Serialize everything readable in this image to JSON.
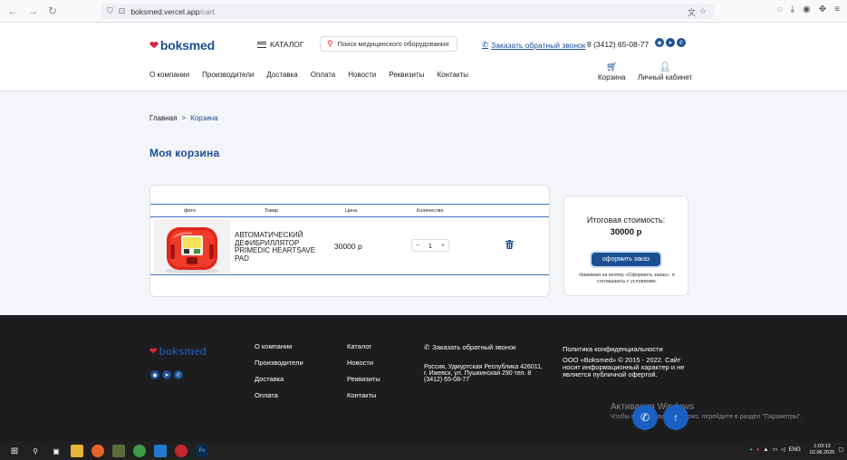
{
  "browser": {
    "url_host": "boksmed.vercel.app",
    "url_path": "/cart"
  },
  "header": {
    "logo": "boksmed",
    "catalog_label": "КАТАЛОГ",
    "search_placeholder": "Поиск медицинского оборудования",
    "callback_label": "Заказать обратный звонок",
    "phone": "8 (3412) 65-08-77",
    "nav": [
      "О компании",
      "Производители",
      "Доставка",
      "Оплата",
      "Новости",
      "Реквизиты",
      "Контакты"
    ],
    "cart_label": "Корзина",
    "account_label": "Личный кабинет"
  },
  "breadcrumb": {
    "home": "Главная",
    "separator": ">",
    "current": "Корзина"
  },
  "page_title": "Моя корзина",
  "cart": {
    "columns": [
      "фото",
      "Товар",
      "Цена",
      "Количество"
    ],
    "items": [
      {
        "name": "АВТОМАТИЧЕСКИЙ ДЕФИБРИЛЛЯТОР PRIMEDIC HEARTSAVE PAD",
        "price": "30000 р",
        "quantity": "1"
      }
    ]
  },
  "summary": {
    "label": "Итоговая стоимость:",
    "total": "30000 р",
    "order_button": "оформить заказ",
    "note": "Нажимая на кнопку «Оформить заказ», я соглашаюсь с условиями."
  },
  "footer": {
    "logo": "boksmed",
    "col1": [
      "О компании",
      "Производители",
      "Доставка",
      "Оплата"
    ],
    "col2": [
      "Каталог",
      "Новости",
      "Реквизиты",
      "Контакты"
    ],
    "callback_label": "Заказать обратный звонок",
    "address": "Россия, Удмуртская Республика 426011, г. Ижевск, ул. Пушкинская 290 тел. 8 (3412) 65-08-77",
    "policy": "Политика конфиденциальности",
    "copyright": "ООО «Boksmed» © 2015 - 2022. Сайт носит информационный характер и не является публичной офертой."
  },
  "activation": {
    "title": "Активация Windows",
    "subtitle": "Чтобы активировать Windows, перейдите в раздел \"Параметры\"."
  },
  "taskbar": {
    "lang": "ENG",
    "time": "1:03:13",
    "date": "02.06.2025"
  },
  "colors": {
    "brand_blue": "#1b4f93",
    "brand_red": "#d8263b",
    "footer_bg": "#1d1d1f"
  }
}
